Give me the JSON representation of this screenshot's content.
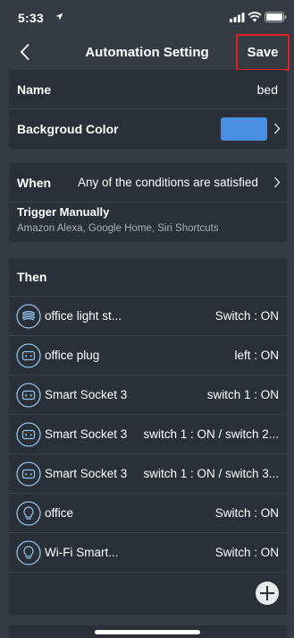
{
  "status": {
    "time": "5:33"
  },
  "nav": {
    "title": "Automation Setting",
    "save_label": "Save"
  },
  "settings": {
    "name_label": "Name",
    "name_value": "bed",
    "color_label": "Backgroud Color",
    "color_value": "#4a8fe2"
  },
  "when": {
    "label": "When",
    "value": "Any of the conditions are satisfied",
    "trigger_title": "Trigger Manually",
    "trigger_sub": "Amazon Alexa, Google Home, Siri Shortcuts"
  },
  "then": {
    "label": "Then",
    "actions": [
      {
        "icon": "light-strip-icon",
        "name": "office light st...",
        "state": "Switch : ON"
      },
      {
        "icon": "plug-icon",
        "name": "office plug",
        "state": "left : ON"
      },
      {
        "icon": "socket-icon",
        "name": "Smart Socket 3",
        "state": "switch 1 : ON"
      },
      {
        "icon": "socket-icon",
        "name": "Smart Socket 3",
        "state": "switch 1 : ON / switch 2..."
      },
      {
        "icon": "socket-icon",
        "name": "Smart Socket 3",
        "state": "switch 1 : ON / switch 3..."
      },
      {
        "icon": "bulb-icon",
        "name": "office",
        "state": "Switch : ON"
      },
      {
        "icon": "bulb-icon",
        "name": "Wi-Fi Smart...",
        "state": "Switch : ON"
      }
    ]
  },
  "colors": {
    "background": "#353a43",
    "card": "#2b2f37",
    "highlight_border": "#e02020",
    "swatch": "#4a8fe2"
  }
}
